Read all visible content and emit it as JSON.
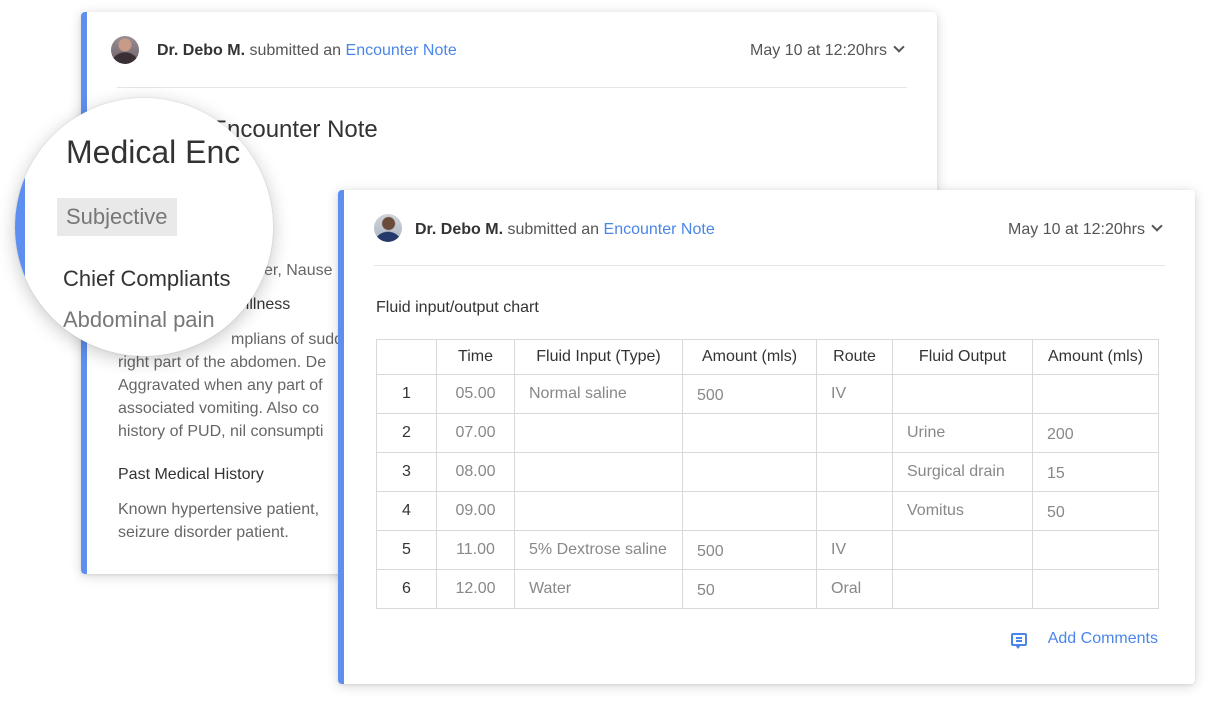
{
  "back_card": {
    "author": "Dr. Debo M.",
    "action": "submitted an",
    "link": "Encounter Note",
    "date": "May 10 at 12:20hrs",
    "title_fragment": "Encounter Note",
    "line_complaints": "ver, Nause",
    "heading_present_illness": "nt illness",
    "present_illness_lines": [
      "mplians of sudden",
      "right part of the abdomen. De",
      "Aggravated when any part of",
      "associated vomiting. Also co",
      "history of PUD, nil consumpti"
    ],
    "heading_past_history": "Past Medical History",
    "past_history_lines": [
      "Known hypertensive patient,",
      "seizure disorder patient."
    ]
  },
  "magnifier": {
    "title": "Medical Enc",
    "chip": "Subjective",
    "section": "Chief Compliants",
    "value": "Abdominal pain"
  },
  "front_card": {
    "author": "Dr. Debo M.",
    "action": "submitted an",
    "link": "Encounter Note",
    "date": "May 10 at 12:20hrs",
    "chart_title": "Fluid input/output chart",
    "table": {
      "headers": [
        "",
        "Time",
        "Fluid Input (Type)",
        "Amount (mls)",
        "Route",
        "Fluid Output",
        "Amount (mls)"
      ],
      "rows": [
        [
          "1",
          "05.00",
          "Normal saline",
          "500",
          "IV",
          "",
          ""
        ],
        [
          "2",
          "07.00",
          "",
          "",
          "",
          "Urine",
          "200"
        ],
        [
          "3",
          "08.00",
          "",
          "",
          "",
          "Surgical drain",
          "15"
        ],
        [
          "4",
          "09.00",
          "",
          "",
          "",
          "Vomitus",
          "50"
        ],
        [
          "5",
          "11.00",
          "5% Dextrose saline",
          "500",
          "IV",
          "",
          ""
        ],
        [
          "6",
          "12.00",
          "Water",
          "50",
          "Oral",
          "",
          ""
        ]
      ]
    },
    "add_comments": "Add Comments"
  },
  "colors": {
    "accent": "#4a86e8",
    "stripe": "#5e8ff0"
  }
}
